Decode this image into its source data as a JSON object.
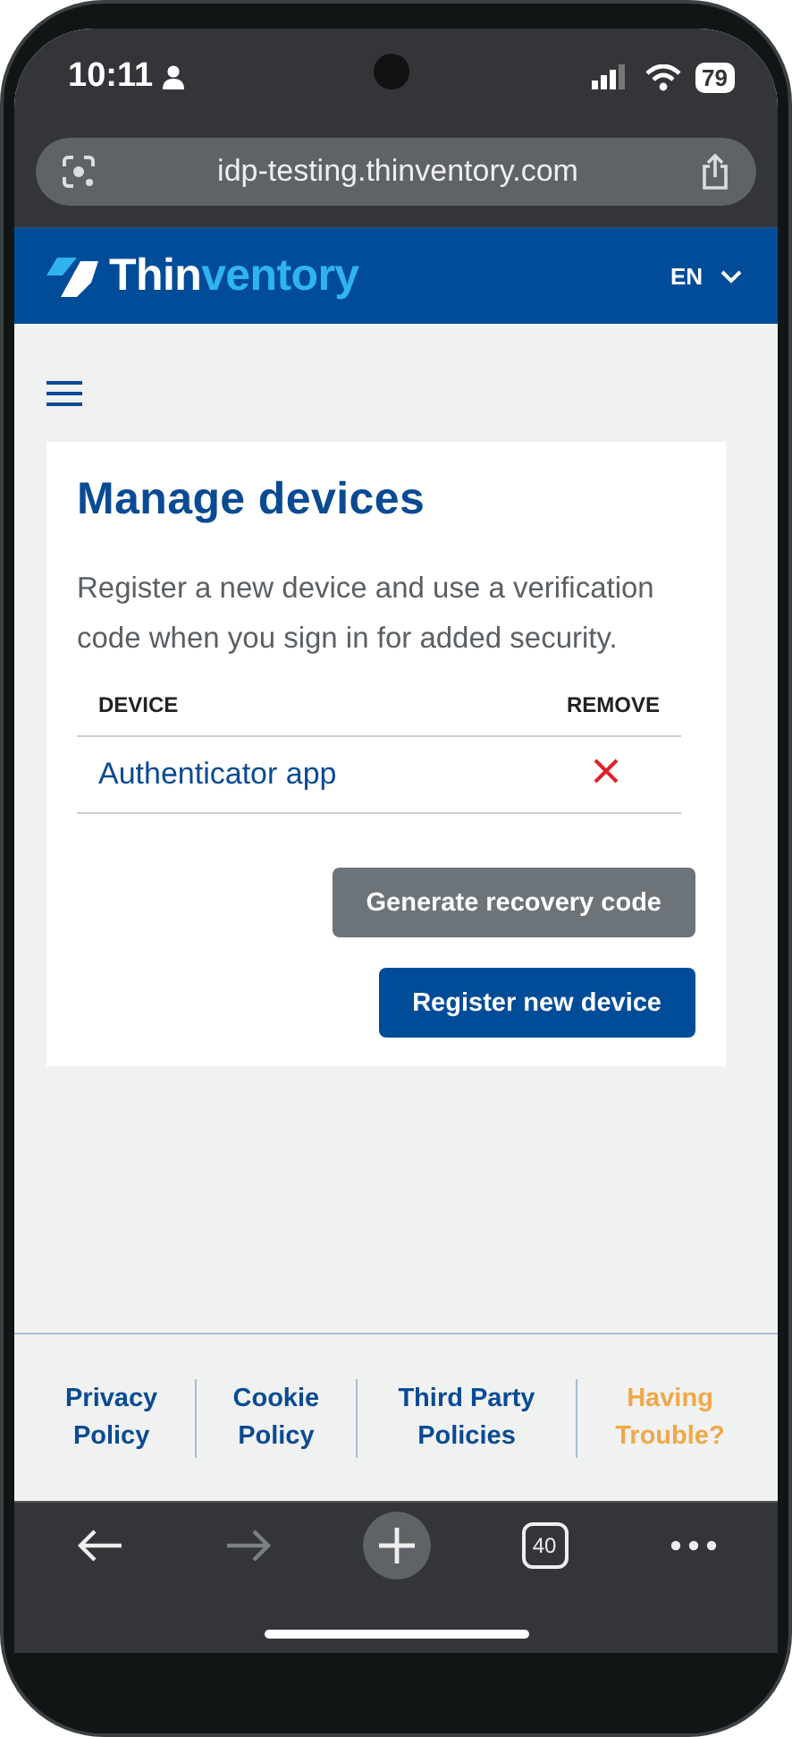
{
  "status_bar": {
    "time": "10:11",
    "battery": "79"
  },
  "address_bar": {
    "url": "idp-testing.thinventory.com"
  },
  "header": {
    "brand_start": "Thin",
    "brand_end": "ventory",
    "language": "EN"
  },
  "card": {
    "title": "Manage devices",
    "description": "Register a new device and use a verification code when you sign in for added security.",
    "columns": [
      "DEVICE",
      "REMOVE"
    ],
    "devices": [
      {
        "name": "Authenticator app"
      }
    ],
    "buttons": [
      {
        "label": "Generate recovery code",
        "kind": "secondary"
      },
      {
        "label": "Register new device",
        "kind": "primary"
      }
    ]
  },
  "footer_links": [
    {
      "label": "Privacy Policy",
      "kind": "link"
    },
    {
      "label": "Cookie Policy",
      "kind": "link"
    },
    {
      "label": "Third Party Policies",
      "kind": "link"
    },
    {
      "label": "Having Trouble?",
      "kind": "help"
    }
  ],
  "browser_nav": [
    {
      "kind": "back",
      "disabled": false
    },
    {
      "kind": "forward",
      "disabled": true
    },
    {
      "kind": "new-tab",
      "disabled": false
    },
    {
      "kind": "tabs",
      "label": "40",
      "disabled": false
    },
    {
      "kind": "more",
      "disabled": false
    }
  ]
}
